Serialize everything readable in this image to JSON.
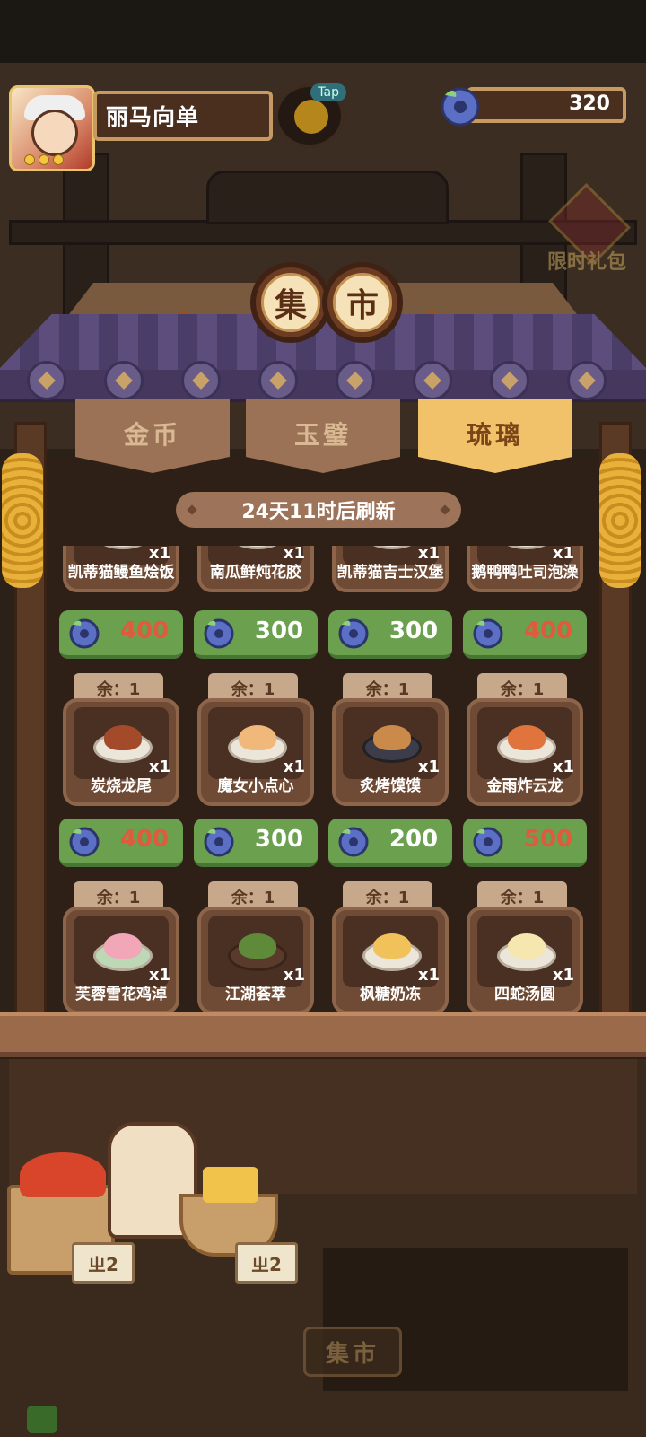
{
  "player": {
    "name": "丽马向单",
    "tap_label": "Tap"
  },
  "currency": {
    "amount": "320",
    "icon": "glaze-gem-icon",
    "color": "#5b6fc4"
  },
  "limited_gift": {
    "label": "限时礼包"
  },
  "market_title": [
    "集",
    "市"
  ],
  "tabs": [
    {
      "label": "金币",
      "active": false
    },
    {
      "label": "玉璧",
      "active": false
    },
    {
      "label": "琉璃",
      "active": true
    }
  ],
  "refresh_text": "24天11时后刷新",
  "rows": [
    {
      "items": [
        {
          "name": "凯蒂猫鳗鱼烩饭",
          "qty": "x1",
          "stock": ""
        },
        {
          "name": "南瓜鲜炖花胶",
          "qty": "x1",
          "stock": ""
        },
        {
          "name": "凯蒂猫吉士汉堡",
          "qty": "x1",
          "stock": ""
        },
        {
          "name": "鹅鸭鸭吐司泡澡",
          "qty": "x1",
          "stock": ""
        }
      ],
      "prices": [
        {
          "value": "400",
          "affordable": false
        },
        {
          "value": "300",
          "affordable": true
        },
        {
          "value": "300",
          "affordable": true
        },
        {
          "value": "400",
          "affordable": false
        }
      ]
    },
    {
      "items": [
        {
          "name": "炭烧龙尾",
          "qty": "x1",
          "stock": "余：1"
        },
        {
          "name": "魔女小点心",
          "qty": "x1",
          "stock": "余：1"
        },
        {
          "name": "炙烤馍馍",
          "qty": "x1",
          "stock": "余：1"
        },
        {
          "name": "金雨炸云龙",
          "qty": "x1",
          "stock": "余：1"
        }
      ],
      "prices": [
        {
          "value": "400",
          "affordable": false
        },
        {
          "value": "300",
          "affordable": true
        },
        {
          "value": "200",
          "affordable": true
        },
        {
          "value": "500",
          "affordable": false
        }
      ]
    },
    {
      "items": [
        {
          "name": "芙蓉雪花鸡淖",
          "qty": "x1",
          "stock": "余：1"
        },
        {
          "name": "江湖荟萃",
          "qty": "x1",
          "stock": "余：1"
        },
        {
          "name": "枫糖奶冻",
          "qty": "x1",
          "stock": "余：1"
        },
        {
          "name": "四蛇汤圆",
          "qty": "x1",
          "stock": "余：1"
        }
      ]
    }
  ],
  "vendors": [
    {
      "sign": "ㄓ2"
    },
    {
      "sign": "ㄓ2"
    }
  ],
  "bottom_button": "集市",
  "colors": {
    "price_green": "#6aa04e",
    "unaffordable_red": "#e05a3d",
    "active_tab": "#f2c26b"
  }
}
